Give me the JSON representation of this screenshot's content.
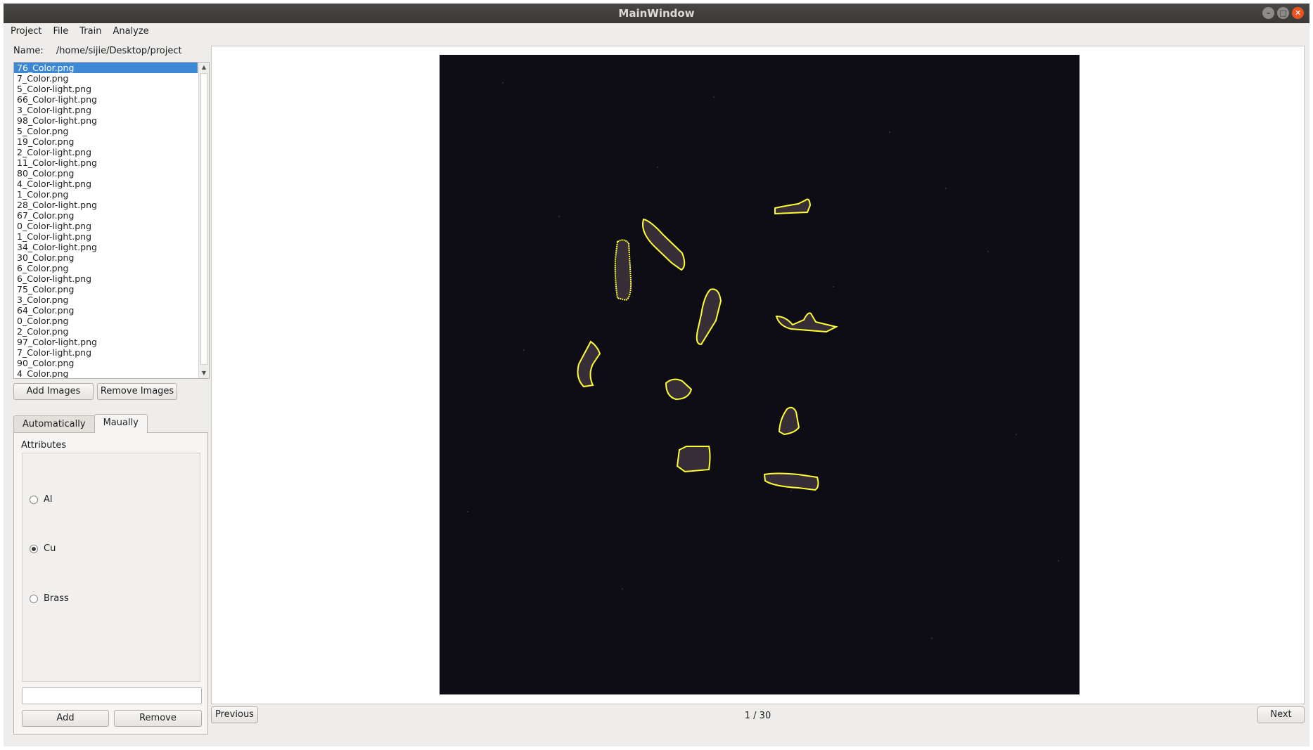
{
  "window": {
    "title": "MainWindow"
  },
  "menu": [
    "Project",
    "File",
    "Train",
    "Analyze"
  ],
  "project": {
    "name_label": "Name:",
    "name_value": "/home/sijie/Desktop/project"
  },
  "file_list": [
    "76_Color.png",
    "7_Color.png",
    "5_Color-light.png",
    "66_Color-light.png",
    "3_Color-light.png",
    "98_Color-light.png",
    "5_Color.png",
    "19_Color.png",
    "2_Color-light.png",
    "11_Color-light.png",
    "80_Color.png",
    "4_Color-light.png",
    "1_Color.png",
    "28_Color-light.png",
    "67_Color.png",
    "0_Color-light.png",
    "1_Color-light.png",
    "34_Color-light.png",
    "30_Color.png",
    "6_Color.png",
    "6_Color-light.png",
    "75_Color.png",
    "3_Color.png",
    "64_Color.png",
    "0_Color.png",
    "2_Color.png",
    "97_Color-light.png",
    "7_Color-light.png",
    "90_Color.png",
    "4_Color.png"
  ],
  "selected_file_index": 0,
  "buttons": {
    "add_images": "Add Images",
    "remove_images": "Remove Images",
    "add": "Add",
    "remove": "Remove",
    "previous": "Previous",
    "next": "Next"
  },
  "tabs": [
    {
      "label": "Automatically",
      "active": false
    },
    {
      "label": "Maually",
      "active": true
    }
  ],
  "attributes": {
    "label": "Attributes",
    "options": [
      {
        "label": "Al",
        "checked": false
      },
      {
        "label": "Cu",
        "checked": true
      },
      {
        "label": "Brass",
        "checked": false
      }
    ],
    "input_value": ""
  },
  "pager": {
    "text": "1 / 30"
  },
  "colors": {
    "selection": "#3d88d4",
    "outline": "#ffff33",
    "image_bg": "#0e0d15"
  }
}
